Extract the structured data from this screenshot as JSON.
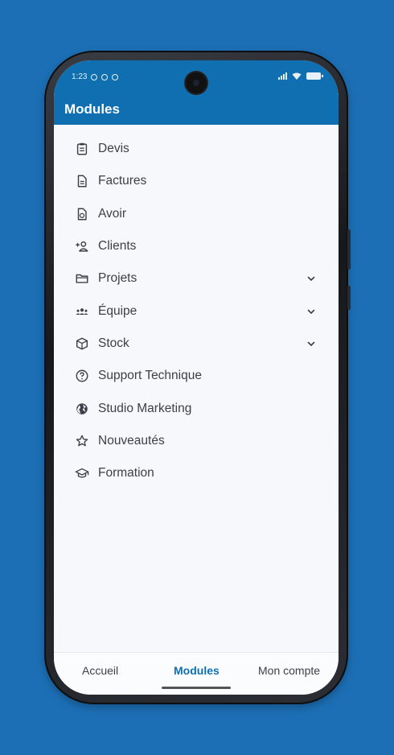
{
  "status_bar": {
    "time": "1:23"
  },
  "header": {
    "title": "Modules"
  },
  "menu": [
    {
      "label": "Devis",
      "icon": "clipboard-icon",
      "expandable": false
    },
    {
      "label": "Factures",
      "icon": "document-icon",
      "expandable": false
    },
    {
      "label": "Avoir",
      "icon": "credit-note-icon",
      "expandable": false
    },
    {
      "label": "Clients",
      "icon": "add-person-icon",
      "expandable": false
    },
    {
      "label": "Projets",
      "icon": "folder-icon",
      "expandable": true
    },
    {
      "label": "Équipe",
      "icon": "team-icon",
      "expandable": true
    },
    {
      "label": "Stock",
      "icon": "box-icon",
      "expandable": true
    },
    {
      "label": "Support Technique",
      "icon": "help-icon",
      "expandable": false
    },
    {
      "label": "Studio Marketing",
      "icon": "globe-icon",
      "expandable": false
    },
    {
      "label": "Nouveautés",
      "icon": "star-icon",
      "expandable": false
    },
    {
      "label": "Formation",
      "icon": "graduation-cap-icon",
      "expandable": false
    }
  ],
  "bottom_nav": {
    "tabs": [
      {
        "label": "Accueil",
        "active": false
      },
      {
        "label": "Modules",
        "active": true
      },
      {
        "label": "Mon compte",
        "active": false
      }
    ]
  },
  "colors": {
    "background": "#1c6fb5",
    "header": "#0f6fb0",
    "active_tab": "#0f6fb0"
  }
}
